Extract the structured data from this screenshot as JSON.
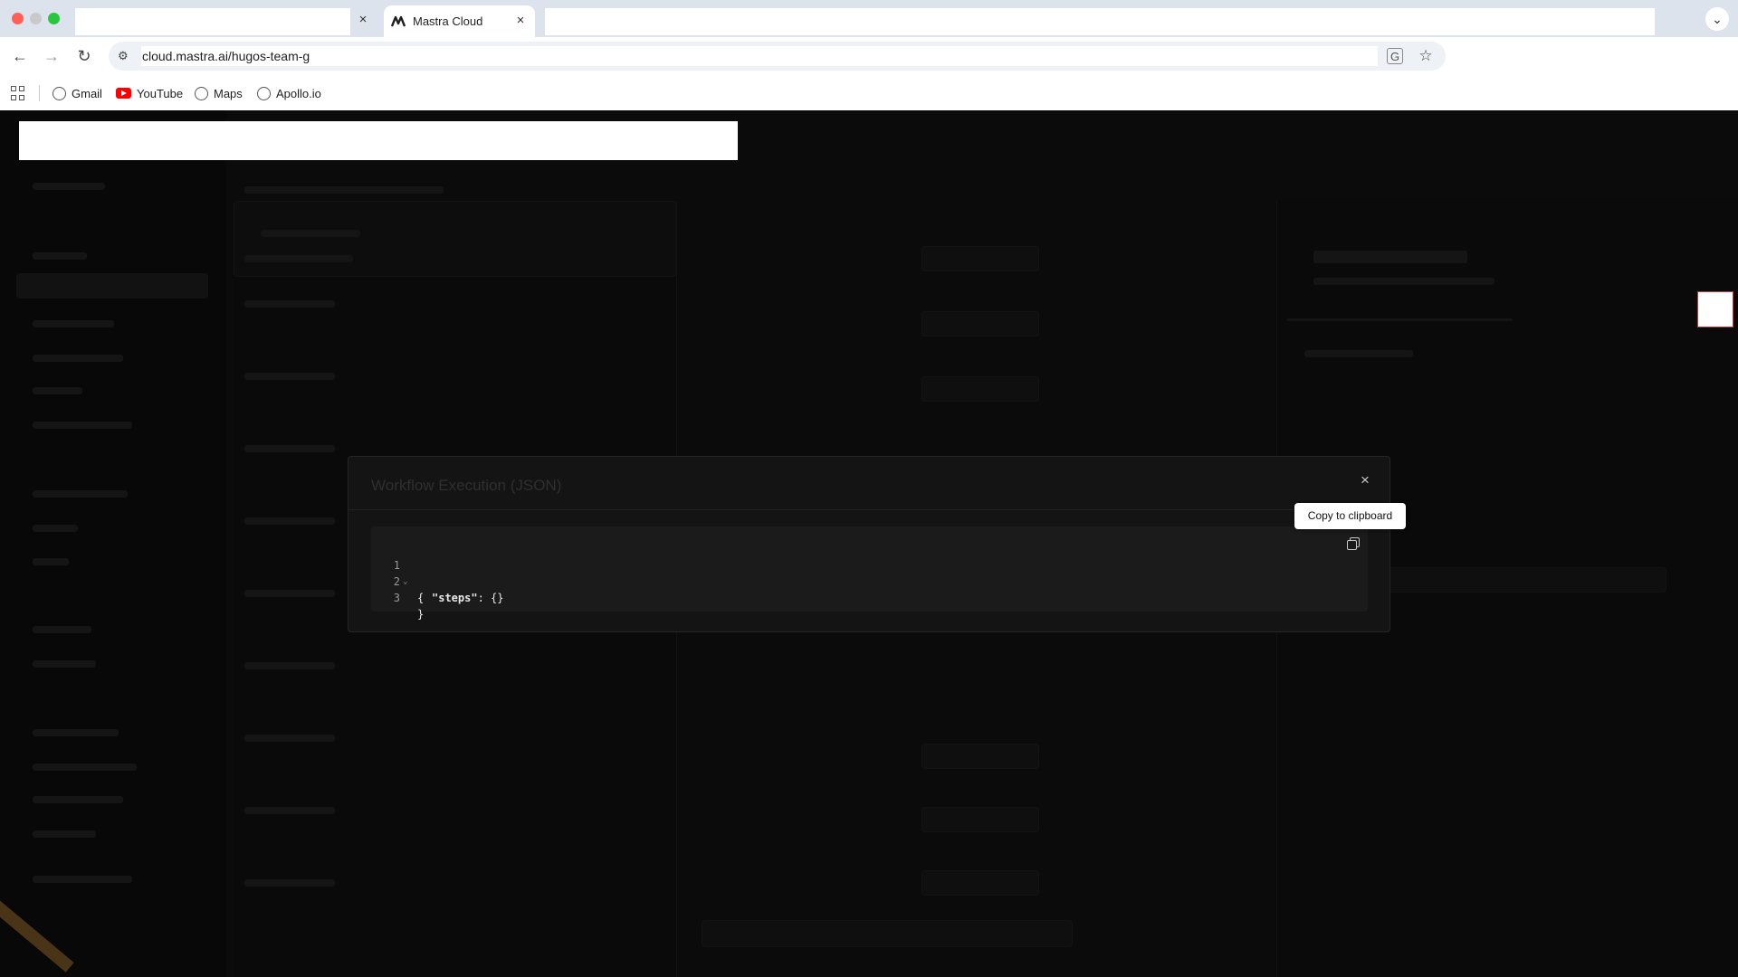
{
  "browser": {
    "active_tab_title": "Mastra Cloud",
    "url": "cloud.mastra.ai/hugos-team-g",
    "bookmarks": [
      {
        "label": "Gmail",
        "icon": "globe-icon"
      },
      {
        "label": "YouTube",
        "icon": "youtube-icon"
      },
      {
        "label": "Maps",
        "icon": "globe-icon"
      },
      {
        "label": "Apollo.io",
        "icon": "globe-icon"
      }
    ]
  },
  "modal": {
    "title": "Workflow Execution (JSON)",
    "close_icon": "×",
    "code_lines": [
      {
        "number": "1",
        "text": "{"
      },
      {
        "number": "2",
        "key": "\"steps\"",
        "rest": ": {}"
      },
      {
        "number": "3",
        "text": "}"
      }
    ]
  },
  "tooltip": {
    "text": "Copy to clipboard"
  },
  "colors": {
    "overlay": "#0b0b0b",
    "modal_bg": "#141414",
    "code_bg": "#1b1b1b"
  }
}
